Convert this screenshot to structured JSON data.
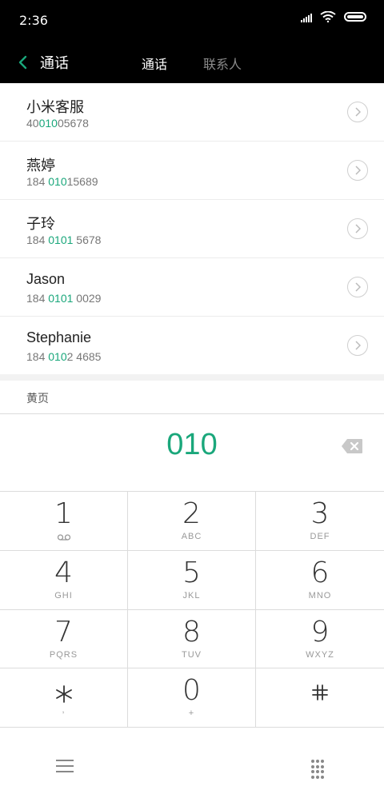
{
  "status_bar": {
    "time": "2:36"
  },
  "header": {
    "title": "通话",
    "tabs": [
      {
        "label": "通话"
      },
      {
        "label": "联系人"
      }
    ]
  },
  "results": [
    {
      "name": "小米客服",
      "number_parts": [
        "40",
        "010",
        "05678"
      ]
    },
    {
      "name": "燕婷",
      "number_parts": [
        "184 ",
        "010",
        "15689"
      ]
    },
    {
      "name": "子玲",
      "number_parts": [
        "184 ",
        "0101",
        " 5678"
      ]
    },
    {
      "name": "Jason",
      "number_parts": [
        "184 ",
        "0101",
        " 0029"
      ]
    },
    {
      "name": "Stephanie",
      "number_parts": [
        "184 ",
        "010",
        "2 4685"
      ]
    }
  ],
  "yellow_pages_label": "黄页",
  "dialed_number": "010",
  "keypad": [
    {
      "digit": "1",
      "letters": "",
      "icon": "voicemail-icon"
    },
    {
      "digit": "2",
      "letters": "ABC"
    },
    {
      "digit": "3",
      "letters": "DEF"
    },
    {
      "digit": "4",
      "letters": "GHI"
    },
    {
      "digit": "5",
      "letters": "JKL"
    },
    {
      "digit": "6",
      "letters": "MNO"
    },
    {
      "digit": "7",
      "letters": "PQRS"
    },
    {
      "digit": "8",
      "letters": "TUV"
    },
    {
      "digit": "9",
      "letters": "WXYZ"
    },
    {
      "digit": "*",
      "letters": ",",
      "icon": "asterisk-icon"
    },
    {
      "digit": "0",
      "letters": "+"
    },
    {
      "digit": "#",
      "letters": "",
      "icon": "pound-icon"
    }
  ],
  "colors": {
    "accent": "#1aa77b",
    "header_bg": "#000000",
    "inactive_tab": "#8a8a8a"
  }
}
